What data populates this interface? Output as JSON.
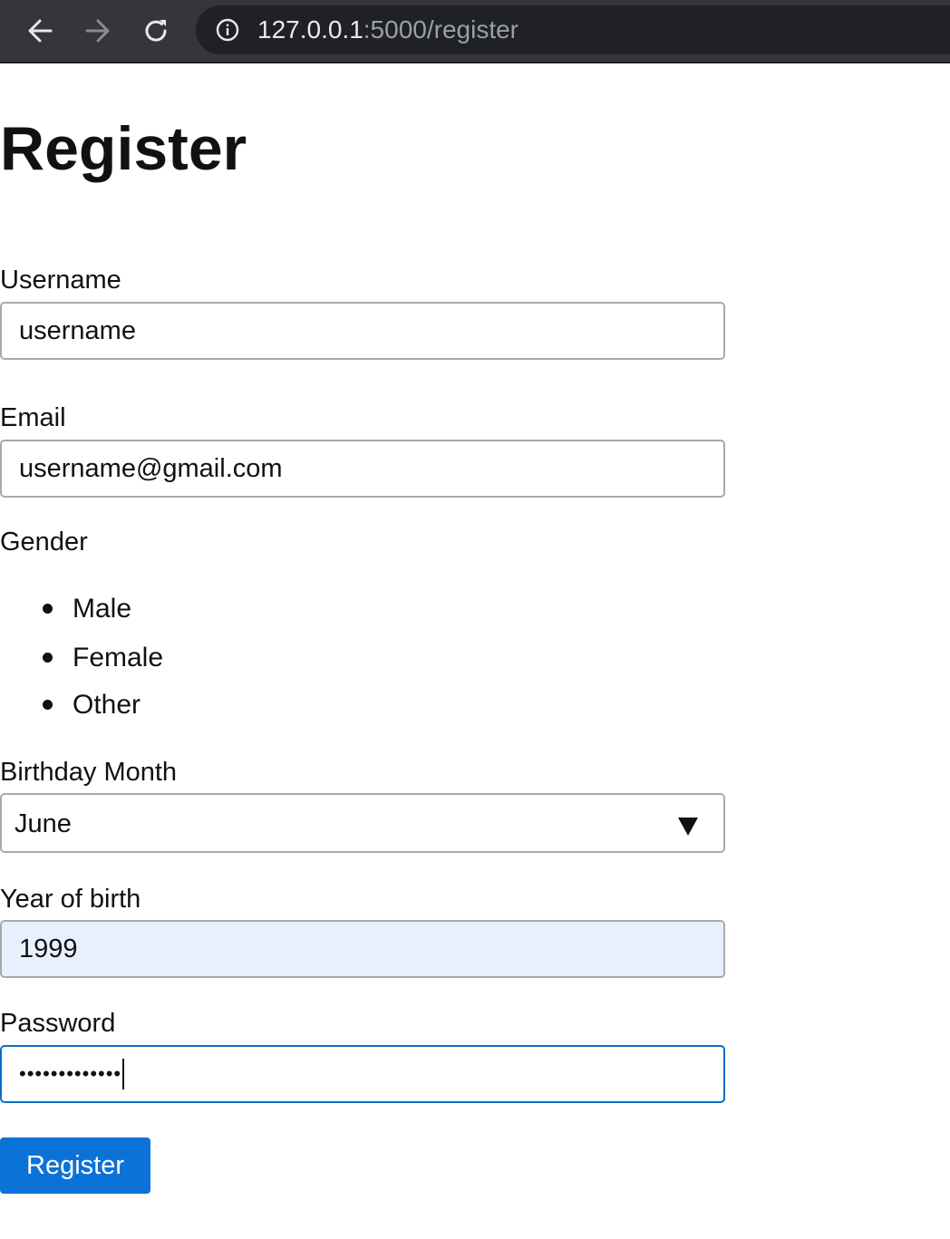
{
  "browser": {
    "url_host": "127.0.0.1",
    "url_path": ":5000/register"
  },
  "page": {
    "title": "Register"
  },
  "form": {
    "username": {
      "label": "Username",
      "value": "username"
    },
    "email": {
      "label": "Email",
      "value": "username@gmail.com"
    },
    "gender": {
      "label": "Gender",
      "options": [
        "Male",
        "Female",
        "Other"
      ]
    },
    "birthday_month": {
      "label": "Birthday Month",
      "value": "June"
    },
    "year_of_birth": {
      "label": "Year of birth",
      "value": "1999"
    },
    "password": {
      "label": "Password",
      "masked_value": "•••••••••••••"
    },
    "submit_label": "Register"
  },
  "colors": {
    "accent": "#0b73d8",
    "autofill_bg": "#e8f0fe",
    "browser_bar": "#35363a"
  }
}
